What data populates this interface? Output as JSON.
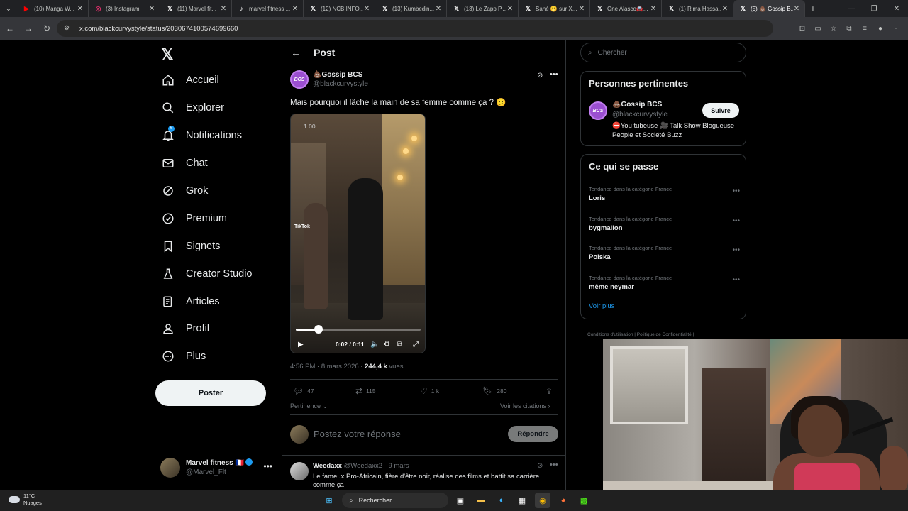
{
  "browser": {
    "tabs": [
      {
        "label": "(10) Manga W...",
        "icon": "youtube-icon",
        "color": "#ff0000"
      },
      {
        "label": "(3) Instagram",
        "icon": "instagram-icon",
        "color": "#e1306c"
      },
      {
        "label": "(11) Marvel fit...",
        "icon": "x-icon",
        "color": "#ffffff"
      },
      {
        "label": "marvel fitness ...",
        "icon": "tiktok-icon",
        "color": "#ffffff"
      },
      {
        "label": "(12) NCB INFO...",
        "icon": "x-icon",
        "color": "#ffffff"
      },
      {
        "label": "(13) Kumbedin...",
        "icon": "x-icon",
        "color": "#ffffff"
      },
      {
        "label": "(13) Le Zapp P...",
        "icon": "x-icon",
        "color": "#ffffff"
      },
      {
        "label": "Sané 🫢 sur X...",
        "icon": "x-icon",
        "color": "#ffffff"
      },
      {
        "label": "One Alasco🚘...",
        "icon": "x-icon",
        "color": "#ffffff"
      },
      {
        "label": "(1) Rima Hassa...",
        "icon": "x-icon",
        "color": "#ffffff"
      },
      {
        "label": "(5) 💩 Gossip B...",
        "icon": "x-icon",
        "color": "#ffffff",
        "active": true
      }
    ],
    "url": "x.com/blackcurvystyle/status/2030674100574699660"
  },
  "sidebar": {
    "logo": "𝕏",
    "items": [
      {
        "label": "Accueil",
        "icon": "home-icon"
      },
      {
        "label": "Explorer",
        "icon": "search-icon"
      },
      {
        "label": "Notifications",
        "icon": "bell-icon",
        "badge": "6"
      },
      {
        "label": "Chat",
        "icon": "mail-icon"
      },
      {
        "label": "Grok",
        "icon": "grok-icon"
      },
      {
        "label": "Premium",
        "icon": "verified-icon"
      },
      {
        "label": "Signets",
        "icon": "bookmark-icon"
      },
      {
        "label": "Creator Studio",
        "icon": "flask-icon"
      },
      {
        "label": "Articles",
        "icon": "article-icon"
      },
      {
        "label": "Profil",
        "icon": "person-icon"
      },
      {
        "label": "Plus",
        "icon": "more-circle-icon"
      }
    ],
    "post_button": "Poster",
    "account": {
      "name": "Marvel fitness 🇫🇷",
      "handle": "@Marvel_Flt"
    }
  },
  "post": {
    "header_title": "Post",
    "author_name": "💩Gossip BCS",
    "author_handle": "@blackcurvystyle",
    "avatar_text": "BCS",
    "text": "Mais pourquoi il lâche la main de sa femme comme ça ? 🫤",
    "video": {
      "rate": "1.00",
      "time": "0:02 / 0:11",
      "progress_fraction": 0.18,
      "watermark": "TikTok"
    },
    "meta_time": "4:56 PM · 8 mars 2026 · ",
    "meta_views": "244,4 k",
    "meta_views_label": " vues",
    "stats": {
      "replies": "47",
      "reposts": "115",
      "likes": "1 k",
      "bookmarks": "280"
    },
    "pertinence": "Pertinence",
    "citations": "Voir les citations",
    "reply_placeholder": "Postez votre réponse",
    "reply_button": "Répondre"
  },
  "comment": {
    "name": "Weedaxx",
    "handle": "@Weedaxx2 · 9 mars",
    "text": "Le fameux Pro-Africain, fière d'être noir, réalise des films et battit sa carrière comme ça"
  },
  "right": {
    "search_placeholder": "Chercher",
    "relevant_title": "Personnes pertinentes",
    "relevant": {
      "name": "💩Gossip BCS",
      "handle": "@blackcurvystyle",
      "bio": "⛔You tubeuse 🎥 Talk Show Blogueuse People et Société Buzz",
      "follow": "Suivre"
    },
    "trends_title": "Ce qui se passe",
    "trends": [
      {
        "category": "Tendance dans la catégorie France",
        "name": "Loris"
      },
      {
        "category": "Tendance dans la catégorie France",
        "name": "bygmalion"
      },
      {
        "category": "Tendance dans la catégorie France",
        "name": "Polska"
      },
      {
        "category": "Tendance dans la catégorie France",
        "name": "même neymar"
      }
    ],
    "see_more": "Voir plus",
    "footer": "Conditions d'utilisation  |  Politique de Confidentialité  |"
  },
  "taskbar": {
    "temp": "11°C",
    "weather": "Nuages",
    "search": "Rechercher"
  }
}
